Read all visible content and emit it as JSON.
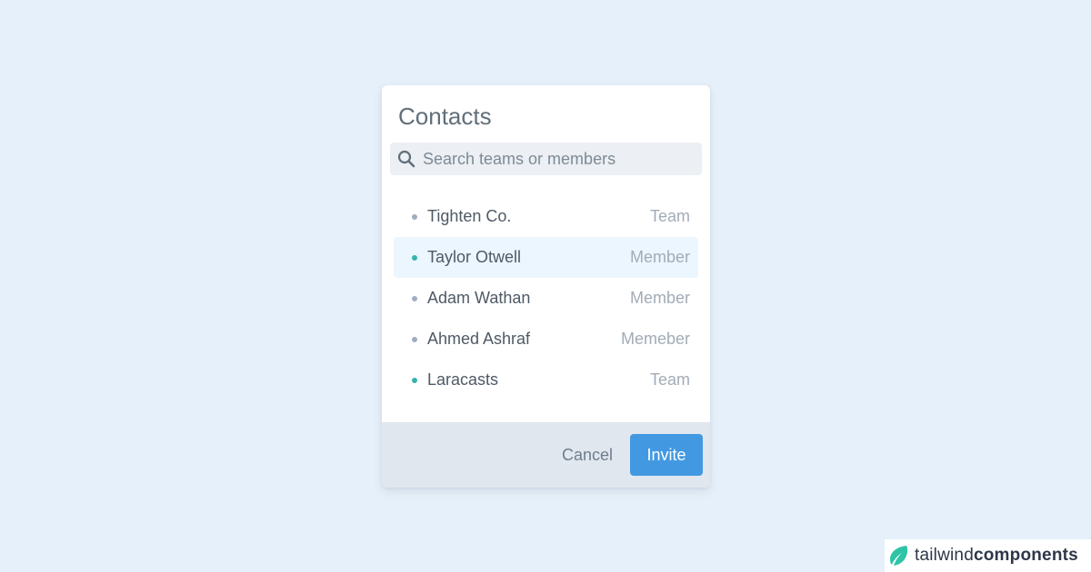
{
  "card": {
    "title": "Contacts"
  },
  "search": {
    "placeholder": "Search teams or members",
    "value": "",
    "icon": "search-icon"
  },
  "contacts": [
    {
      "name": "Tighten Co.",
      "role": "Team",
      "status_color": "#a0aec0",
      "active": false
    },
    {
      "name": "Taylor Otwell",
      "role": "Member",
      "status_color": "#38b2ac",
      "active": true
    },
    {
      "name": "Adam Wathan",
      "role": "Member",
      "status_color": "#a0aec0",
      "active": false
    },
    {
      "name": "Ahmed Ashraf",
      "role": "Memeber",
      "status_color": "#a0aec0",
      "active": false
    },
    {
      "name": "Laracasts",
      "role": "Team",
      "status_color": "#38b2ac",
      "active": false
    }
  ],
  "footer": {
    "cancel_label": "Cancel",
    "invite_label": "Invite"
  },
  "brand": {
    "light": "tailwind",
    "bold": "components",
    "icon": "leaf-icon"
  },
  "colors": {
    "background": "#e6f0fa",
    "accent": "#4299e1",
    "active_row": "#ebf6fe",
    "online": "#38b2ac",
    "offline": "#a0aec0",
    "brand_icon": "#2ec4a6"
  }
}
